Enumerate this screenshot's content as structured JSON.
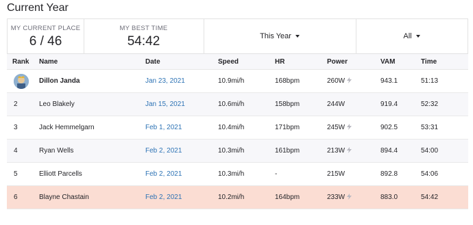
{
  "page": {
    "title": "Current Year"
  },
  "stats": {
    "place_label": "MY CURRENT PLACE",
    "place_value": "6 / 46",
    "best_label": "MY BEST TIME",
    "best_value": "54:42"
  },
  "filters": {
    "period": "This Year",
    "scope": "All"
  },
  "table": {
    "headers": {
      "rank": "Rank",
      "name": "Name",
      "date": "Date",
      "speed": "Speed",
      "hr": "HR",
      "power": "Power",
      "vam": "VAM",
      "time": "Time"
    },
    "rows": [
      {
        "rank": "",
        "name": "Dillon Janda",
        "date": "Jan 23, 2021",
        "speed": "10.9mi/h",
        "hr": "168bpm",
        "power": "260W",
        "vam": "943.1",
        "time": "51:13"
      },
      {
        "rank": "2",
        "name": "Leo Blakely",
        "date": "Jan 15, 2021",
        "speed": "10.6mi/h",
        "hr": "158bpm",
        "power": "244W",
        "vam": "919.4",
        "time": "52:32"
      },
      {
        "rank": "3",
        "name": "Jack Hemmelgarn",
        "date": "Feb 1, 2021",
        "speed": "10.4mi/h",
        "hr": "171bpm",
        "power": "245W",
        "vam": "902.5",
        "time": "53:31"
      },
      {
        "rank": "4",
        "name": "Ryan Wells",
        "date": "Feb 2, 2021",
        "speed": "10.3mi/h",
        "hr": "161bpm",
        "power": "213W",
        "vam": "894.4",
        "time": "54:00"
      },
      {
        "rank": "5",
        "name": "Elliott Parcells",
        "date": "Feb 2, 2021",
        "speed": "10.3mi/h",
        "hr": "-",
        "power": "215W",
        "vam": "892.8",
        "time": "54:06"
      },
      {
        "rank": "6",
        "name": "Blayne Chastain",
        "date": "Feb 2, 2021",
        "speed": "10.2mi/h",
        "hr": "164bpm",
        "power": "233W",
        "vam": "883.0",
        "time": "54:42"
      }
    ]
  },
  "icons": {
    "avatar": "kom-crown-avatar-icon",
    "power_meter": "lightning-bolt-icon",
    "dropdown": "caret-down-icon"
  },
  "colors": {
    "link": "#2d73b5",
    "highlight_row": "#fbddd3",
    "header_bg": "#f7f7fa"
  }
}
